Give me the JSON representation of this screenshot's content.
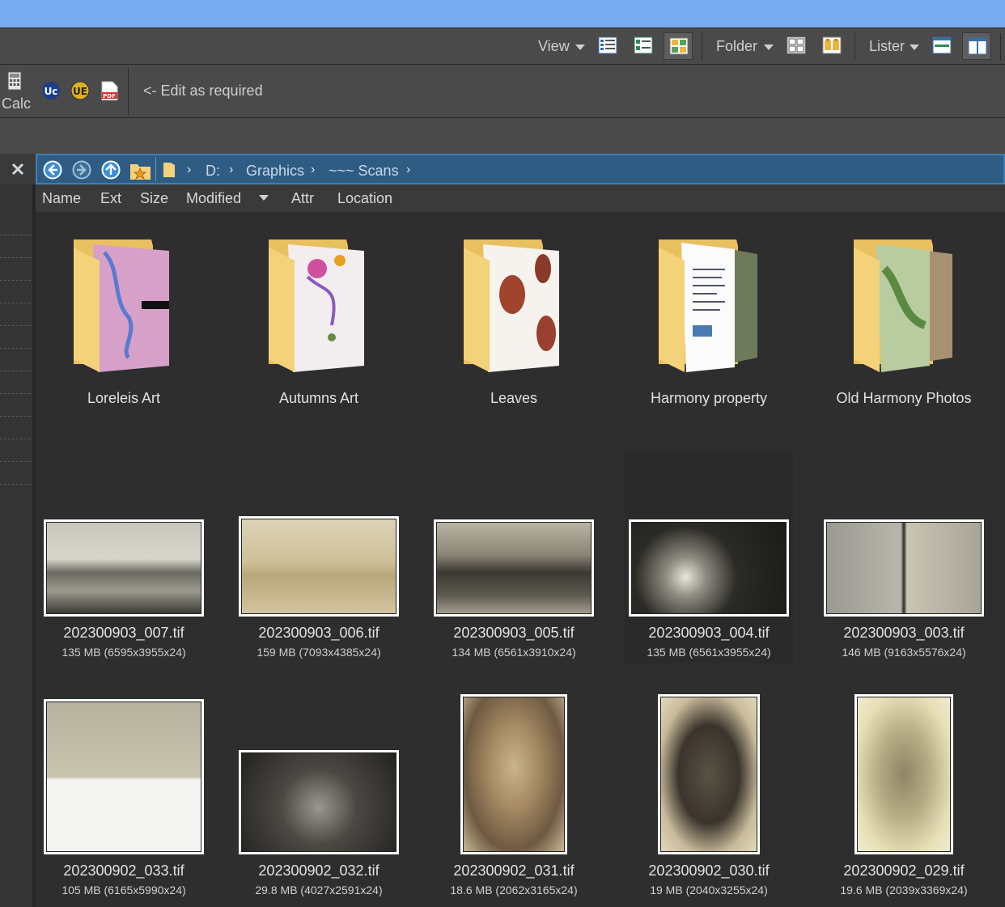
{
  "toolbar": {
    "view_label": "View",
    "folder_label": "Folder",
    "lister_label": "Lister"
  },
  "buttons": {
    "calc_label": "Calc",
    "edit_hint": "<- Edit as required"
  },
  "path": {
    "segments": [
      "D:",
      "Graphics",
      "~~~ Scans"
    ]
  },
  "columns": [
    "Name",
    "Ext",
    "Size",
    "Modified",
    "Attr",
    "Location"
  ],
  "folders": [
    {
      "name": "Loreleis Art"
    },
    {
      "name": "Autumns Art"
    },
    {
      "name": "Leaves"
    },
    {
      "name": "Harmony property"
    },
    {
      "name": "Old Harmony Photos"
    }
  ],
  "files_row1": [
    {
      "name": "202300903_007.tif",
      "meta": "135 MB (6595x3955x24)"
    },
    {
      "name": "202300903_006.tif",
      "meta": "159 MB (7093x4385x24)"
    },
    {
      "name": "202300903_005.tif",
      "meta": "134 MB (6561x3910x24)"
    },
    {
      "name": "202300903_004.tif",
      "meta": "135 MB (6561x3955x24)"
    },
    {
      "name": "202300903_003.tif",
      "meta": "146 MB (9163x5576x24)"
    }
  ],
  "files_row2": [
    {
      "name": "202300902_033.tif",
      "meta": "105 MB (6165x5990x24)"
    },
    {
      "name": "202300902_032.tif",
      "meta": "29.8 MB (4027x2591x24)"
    },
    {
      "name": "202300902_031.tif",
      "meta": "18.6 MB (2062x3165x24)"
    },
    {
      "name": "202300902_030.tif",
      "meta": "19 MB (2040x3255x24)"
    },
    {
      "name": "202300902_029.tif",
      "meta": "19.6 MB (2039x3369x24)"
    }
  ],
  "colors": {
    "titlebar": "#78aaf0",
    "toolbar": "#4a4a4a",
    "pathbar": "#2f5c83",
    "background": "#2e2e2e",
    "folder": "#f3d27a"
  }
}
